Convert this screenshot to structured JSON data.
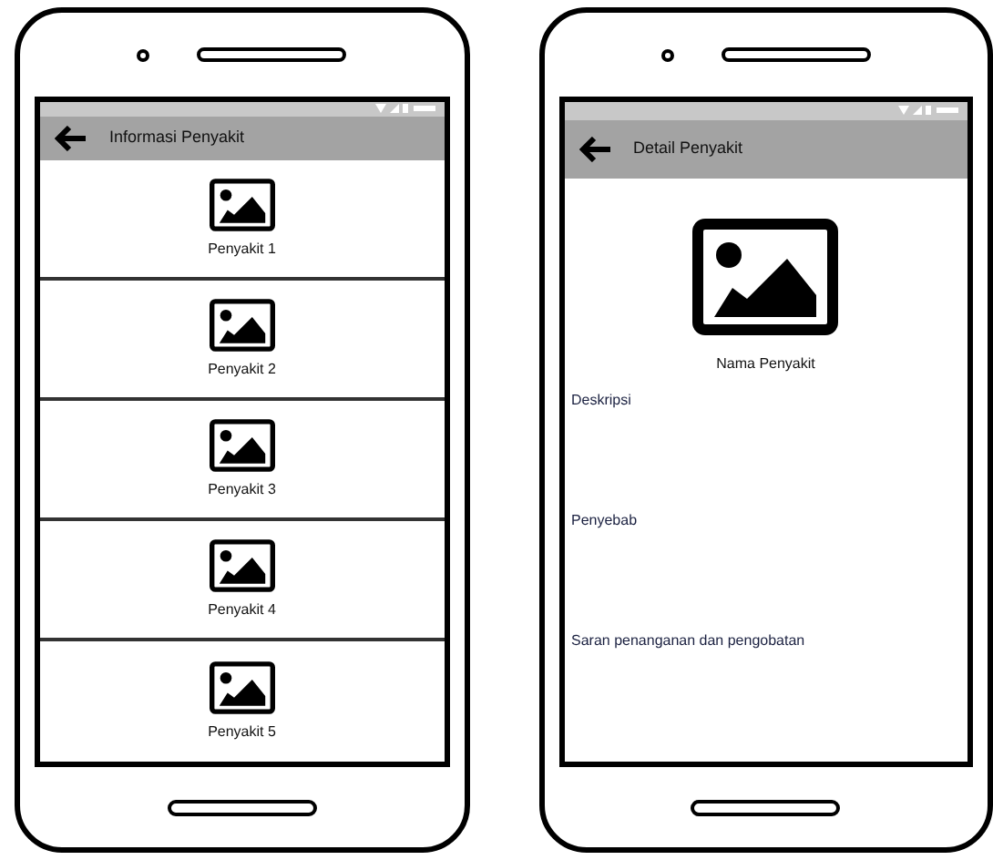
{
  "phones": [
    {
      "kind": "list",
      "app_bar": {
        "title": "Informasi Penyakit"
      },
      "items": [
        {
          "label": "Penyakit 1"
        },
        {
          "label": "Penyakit 2"
        },
        {
          "label": "Penyakit 3"
        },
        {
          "label": "Penyakit 4"
        },
        {
          "label": "Penyakit 5"
        }
      ]
    },
    {
      "kind": "detail",
      "app_bar": {
        "title": "Detail Penyakit"
      },
      "name": "Nama Penyakit",
      "sections": [
        "Deskripsi",
        "Penyebab",
        "Saran penanganan dan pengobatan"
      ]
    }
  ]
}
